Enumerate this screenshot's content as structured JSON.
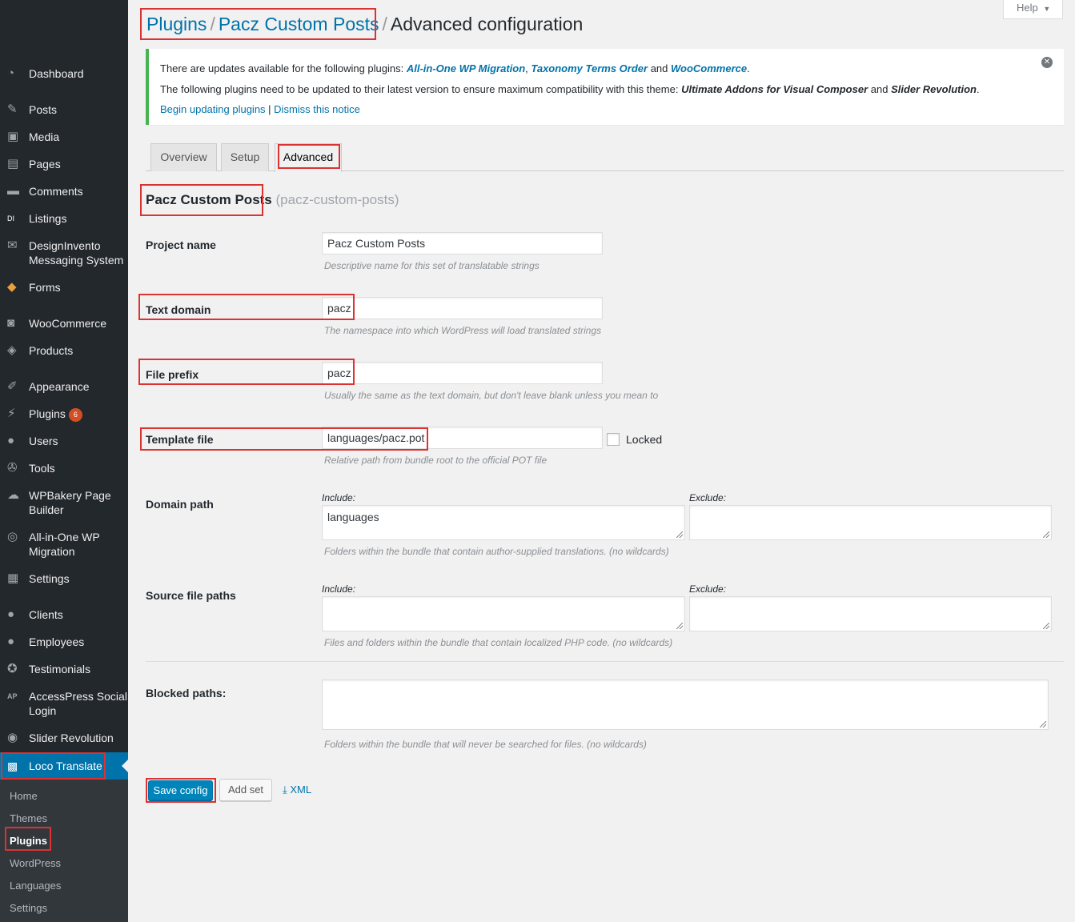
{
  "sidebar": {
    "items": [
      {
        "icon": "dashboard-icon",
        "glyph": "◔",
        "label": "Dashboard"
      },
      {
        "icon": "posts-icon",
        "glyph": "✎",
        "label": "Posts"
      },
      {
        "icon": "media-icon",
        "glyph": "▣",
        "label": "Media"
      },
      {
        "icon": "pages-icon",
        "glyph": "▤",
        "label": "Pages"
      },
      {
        "icon": "comments-icon",
        "glyph": "▬",
        "label": "Comments"
      },
      {
        "icon": "listings-icon",
        "glyph": "DI",
        "label": "Listings"
      },
      {
        "icon": "messaging-icon",
        "glyph": "✉",
        "label": "DesignInvento Messaging System"
      },
      {
        "icon": "forms-icon",
        "glyph": "◆",
        "label": "Forms"
      },
      {
        "icon": "woocommerce-icon",
        "glyph": "◙",
        "label": "WooCommerce"
      },
      {
        "icon": "products-icon",
        "glyph": "◈",
        "label": "Products"
      },
      {
        "icon": "appearance-icon",
        "glyph": "✐",
        "label": "Appearance"
      },
      {
        "icon": "plugins-icon",
        "glyph": "⚡",
        "label": "Plugins",
        "badge": "6"
      },
      {
        "icon": "users-icon",
        "glyph": "●",
        "label": "Users"
      },
      {
        "icon": "tools-icon",
        "glyph": "✇",
        "label": "Tools"
      },
      {
        "icon": "wpbakery-icon",
        "glyph": "☁",
        "label": "WPBakery Page Builder"
      },
      {
        "icon": "migration-icon",
        "glyph": "◎",
        "label": "All-in-One WP Migration"
      },
      {
        "icon": "settings-icon",
        "glyph": "▦",
        "label": "Settings"
      },
      {
        "icon": "clients-icon",
        "glyph": "●",
        "label": "Clients"
      },
      {
        "icon": "employees-icon",
        "glyph": "●",
        "label": "Employees"
      },
      {
        "icon": "testimonials-icon",
        "glyph": "✪",
        "label": "Testimonials"
      },
      {
        "icon": "accesspress-icon",
        "glyph": "AP",
        "label": "AccessPress Social Login"
      },
      {
        "icon": "slider-revolution-icon",
        "glyph": "◉",
        "label": "Slider Revolution"
      }
    ],
    "active": {
      "icon": "loco-translate-icon",
      "glyph": "▩",
      "label": "Loco Translate"
    },
    "submenu": [
      "Home",
      "Themes",
      "Plugins",
      "WordPress",
      "Languages",
      "Settings"
    ],
    "submenu_current": "Plugins"
  },
  "header": {
    "help_label": "Help",
    "help_arrow": "▼",
    "breadcrumb": [
      "Plugins",
      "Pacz Custom Posts",
      "Advanced configuration"
    ],
    "separator": "/"
  },
  "notice": {
    "line1_prefix": "There are updates available for the following plugins: ",
    "line1_links": [
      "All-in-One WP Migration",
      "Taxonomy Terms Order",
      "WooCommerce"
    ],
    "line1_sep": ", ",
    "line1_and": " and ",
    "line1_end": ".",
    "line2_prefix": "The following plugins need to be updated to their latest version to ensure maximum compatibility with this theme: ",
    "line2_items": [
      "Ultimate Addons for Visual Composer",
      "Slider Revolution"
    ],
    "line2_and": " and ",
    "line2_end": ".",
    "action_begin": "Begin updating plugins",
    "action_sep": " | ",
    "action_dismiss": "Dismiss this notice",
    "close_glyph": "✕"
  },
  "tabs": [
    "Overview",
    "Setup",
    "Advanced"
  ],
  "active_tab": "Advanced",
  "project": {
    "title": "Pacz Custom Posts",
    "slug": "(pacz-custom-posts)"
  },
  "form": {
    "project_name": {
      "label": "Project name",
      "value": "Pacz  Custom Posts",
      "help": "Descriptive name for this set of translatable strings"
    },
    "text_domain": {
      "label": "Text domain",
      "value": "pacz",
      "help": "The namespace into which WordPress will load translated strings"
    },
    "file_prefix": {
      "label": "File prefix",
      "value": "pacz",
      "help": "Usually the same as the text domain, but don't leave blank unless you mean to"
    },
    "template_file": {
      "label": "Template file",
      "value": "languages/pacz.pot",
      "help": "Relative path from bundle root to the official POT file",
      "locked_label": "Locked",
      "locked": false
    },
    "domain_path": {
      "label": "Domain path",
      "include_label": "Include:",
      "exclude_label": "Exclude:",
      "include_value": "languages",
      "exclude_value": "",
      "help": "Folders within the bundle that contain author-supplied translations. (no wildcards)"
    },
    "source_paths": {
      "label": "Source file paths",
      "include_label": "Include:",
      "exclude_label": "Exclude:",
      "include_value": "",
      "exclude_value": "",
      "help": "Files and folders within the bundle that contain localized PHP code. (no wildcards)"
    },
    "blocked_paths": {
      "label": "Blocked paths:",
      "value": "",
      "help": "Folders within the bundle that will never be searched for files. (no wildcards)"
    }
  },
  "buttons": {
    "save": "Save config",
    "add_set": "Add set",
    "xml": "XML",
    "xml_icon": "⤓"
  },
  "colors": {
    "accent": "#0073aa",
    "highlight_border": "#dc3232",
    "notice_border": "#46b450",
    "sidebar_bg": "#23282d"
  }
}
